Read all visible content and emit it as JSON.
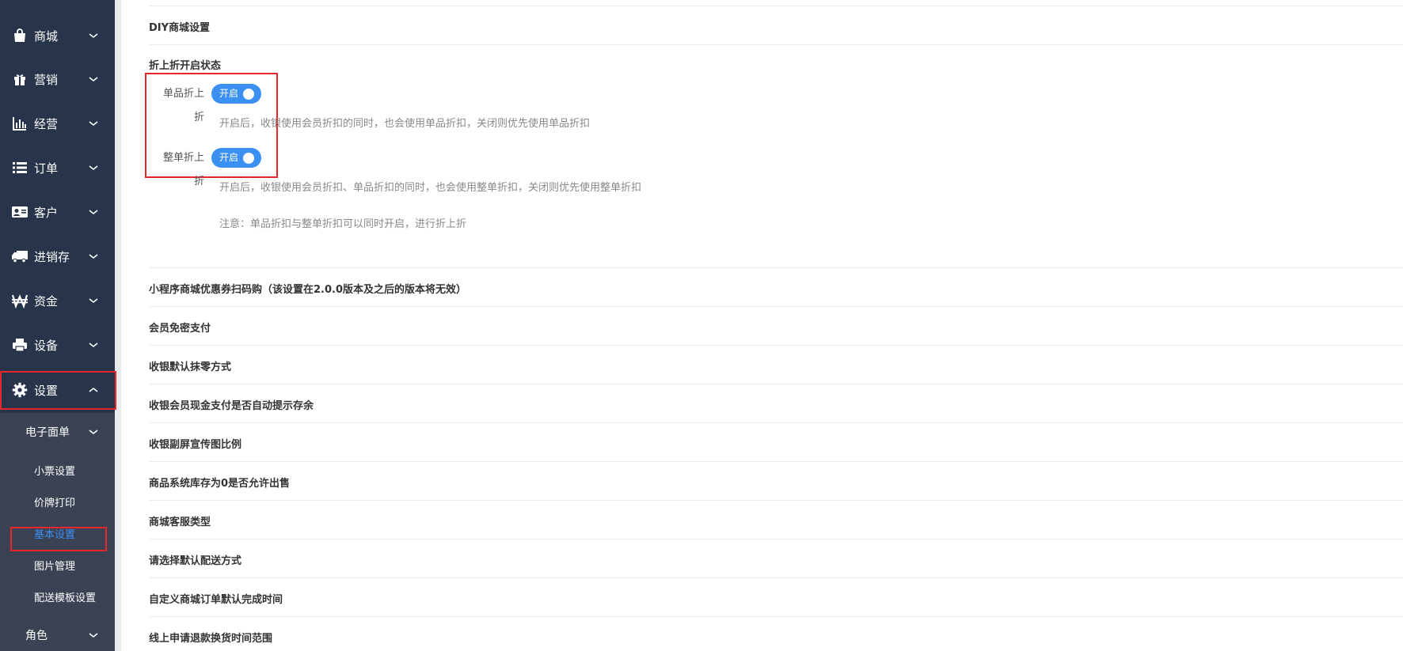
{
  "sidebar": {
    "items": [
      {
        "label": "商城",
        "icon": "shopping-bag-icon"
      },
      {
        "label": "营销",
        "icon": "gift-icon"
      },
      {
        "label": "经营",
        "icon": "bar-chart-icon"
      },
      {
        "label": "订单",
        "icon": "list-icon"
      },
      {
        "label": "客户",
        "icon": "id-card-icon"
      },
      {
        "label": "进销存",
        "icon": "truck-icon"
      },
      {
        "label": "资金",
        "icon": "won-icon"
      },
      {
        "label": "设备",
        "icon": "printer-icon"
      },
      {
        "label": "设置",
        "icon": "gear-icon",
        "expanded": true
      }
    ],
    "electronic_form": {
      "label": "电子面单"
    },
    "sub_items": [
      {
        "label": "小票设置"
      },
      {
        "label": "价牌打印"
      },
      {
        "label": "基本设置",
        "active": true
      },
      {
        "label": "图片管理"
      },
      {
        "label": "配送模板设置"
      }
    ],
    "role": {
      "label": "角色"
    }
  },
  "main": {
    "diy_title": "DIY商城设置",
    "discount_section": {
      "title": "折上折开启状态",
      "single": {
        "label_line1": "单品折上",
        "label_line2": "折",
        "toggle": "开启",
        "hint": "开启后，收银使用会员折扣的同时，也会使用单品折扣，关闭则优先使用单品折扣"
      },
      "whole": {
        "label_line1": "整单折上",
        "label_line2": "折",
        "toggle": "开启",
        "hint": "开启后，收银使用会员折扣、单品折扣的同时，也会使用整单折扣，关闭则优先使用整单折扣"
      },
      "note": "注意：单品折扣与整单折扣可以同时开启，进行折上折"
    },
    "sections": [
      "小程序商城优惠券扫码购（该设置在2.0.0版本及之后的版本将无效）",
      "会员免密支付",
      "收银默认抹零方式",
      "收银会员现金支付是否自动提示存余",
      "收银副屏宣传图比例",
      "商品系统库存为0是否允许出售",
      "商城客服类型",
      "请选择默认配送方式",
      "自定义商城订单默认完成时间",
      "线上申请退款换货时间范围"
    ]
  },
  "colors": {
    "sidebar_bg": "#27344a",
    "submenu_bg": "#3a4253",
    "active_text": "#3d8ff4",
    "toggle_on": "#3b90f3",
    "highlight_border": "#e8272a"
  }
}
